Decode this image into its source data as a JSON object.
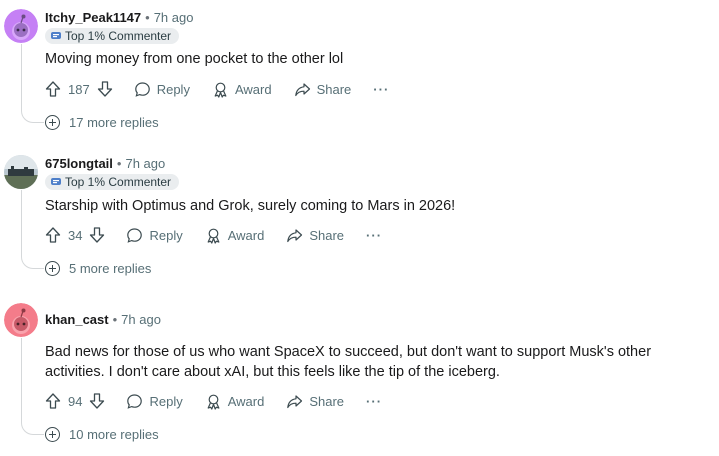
{
  "comments": [
    {
      "username": "Itchy_Peak1147",
      "time": "7h ago",
      "flair": "Top 1% Commenter",
      "avatar_color": "#c580f5",
      "body": "Moving money from one pocket to the other lol",
      "votes": "187",
      "reply_label": "Reply",
      "award_label": "Award",
      "share_label": "Share",
      "more_label": "···",
      "more_replies": "17 more replies"
    },
    {
      "username": "675longtail",
      "time": "7h ago",
      "flair": "Top 1% Commenter",
      "avatar_color": "#8aa1b1",
      "body": "Starship with Optimus and Grok, surely coming to Mars in 2026!",
      "votes": "34",
      "reply_label": "Reply",
      "award_label": "Award",
      "share_label": "Share",
      "more_label": "···",
      "more_replies": "5 more replies"
    },
    {
      "username": "khan_cast",
      "time": "7h ago",
      "avatar_color": "#f47c8a",
      "body": "Bad news for those of us who want SpaceX to succeed, but don't want to support Musk's other activities. I don't care about xAI, but this feels like the tip of the iceberg.",
      "votes": "94",
      "reply_label": "Reply",
      "award_label": "Award",
      "share_label": "Share",
      "more_label": "···",
      "more_replies": "10 more replies"
    }
  ],
  "separator": "•",
  "colors": {
    "text": "#1a1a1b",
    "meta": "#576f76",
    "flair_bg": "#eaedef",
    "thread_line": "#d5d8da"
  }
}
